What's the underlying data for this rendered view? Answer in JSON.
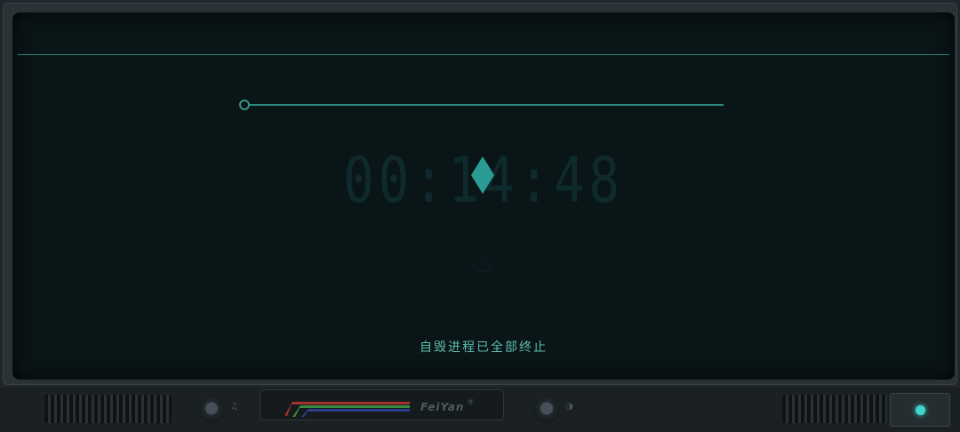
{
  "screen": {
    "timer": "00:14:48",
    "status_text": "自毁进程已全部终止",
    "progress": 0.0
  },
  "device": {
    "brand": "FeiYan",
    "left_knob_icon": "music-note-icon",
    "right_knob_icon": "contrast-icon",
    "power_led_color": "#3fd6cc"
  }
}
